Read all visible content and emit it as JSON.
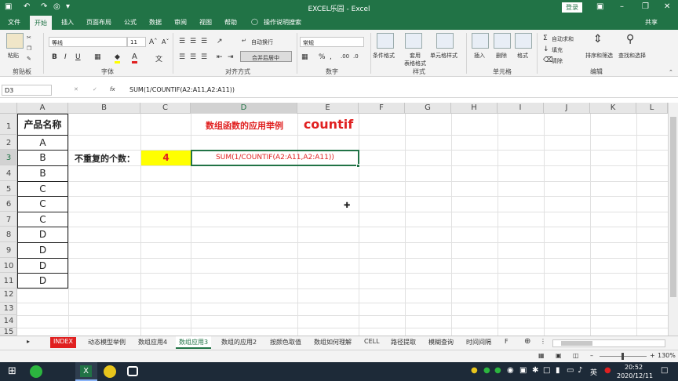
{
  "titlebar": {
    "title": "EXCEL乐园 - Excel",
    "login": "登录"
  },
  "tabs": [
    "文件",
    "开始",
    "插入",
    "页面布局",
    "公式",
    "数据",
    "审阅",
    "视图",
    "帮助",
    "操作说明搜索",
    "共享"
  ],
  "ribbon": {
    "paste": "粘贴",
    "font_name": "等线",
    "font_size": "11",
    "wrap": "自动换行",
    "merge": "合并后居中",
    "number_format": "常规",
    "cond_format": "条件格式",
    "table_format": "套用\n表格格式",
    "cell_style": "单元格样式",
    "insert": "插入",
    "delete": "删除",
    "format": "格式",
    "autosum": "自动求和",
    "fill": "填充",
    "clear": "清除",
    "sort": "排序和筛选",
    "find": "查找和选择",
    "groups": [
      "剪贴板",
      "字体",
      "对齐方式",
      "数字",
      "样式",
      "单元格",
      "编辑"
    ]
  },
  "formula_bar": {
    "name_box": "D3",
    "fx": "fx",
    "formula": "SUM(1/COUNTIF(A2:A11,A2:A11))"
  },
  "columns": [
    "A",
    "B",
    "C",
    "D",
    "E",
    "F",
    "G",
    "H",
    "I",
    "J",
    "K",
    "L"
  ],
  "rows": [
    "1",
    "2",
    "3",
    "4",
    "5",
    "6",
    "7",
    "8",
    "9",
    "10",
    "11",
    "12",
    "13",
    "14",
    "15"
  ],
  "cells": {
    "A1": "产品名称",
    "A2": "A",
    "A3": "B",
    "A4": "B",
    "A5": "C",
    "A6": "C",
    "A7": "C",
    "A8": "D",
    "A9": "D",
    "A10": "D",
    "A11": "D",
    "B3": "不重复的个数：",
    "C3": "4",
    "D1": "数组函数的应用举例",
    "D3": "SUM(1/COUNTIF(A2:A11,A2:A11))",
    "E1": "countif"
  },
  "sheet_tabs": [
    "INDEX",
    "动态模型举例",
    "数组应用4",
    "数组应用3",
    "数组的应用2",
    "按颜色取值",
    "数组如何理解",
    "CELL",
    "路径提取",
    "模糊查询",
    "时间间隔",
    "F"
  ],
  "status": {
    "zoom": "130%"
  },
  "taskbar": {
    "time": "20:52",
    "date": "2020/12/11",
    "ime": "英"
  },
  "colors": {
    "excel_green": "#217346",
    "red_text": "#e02020",
    "yellow_fill": "#ffff00"
  }
}
